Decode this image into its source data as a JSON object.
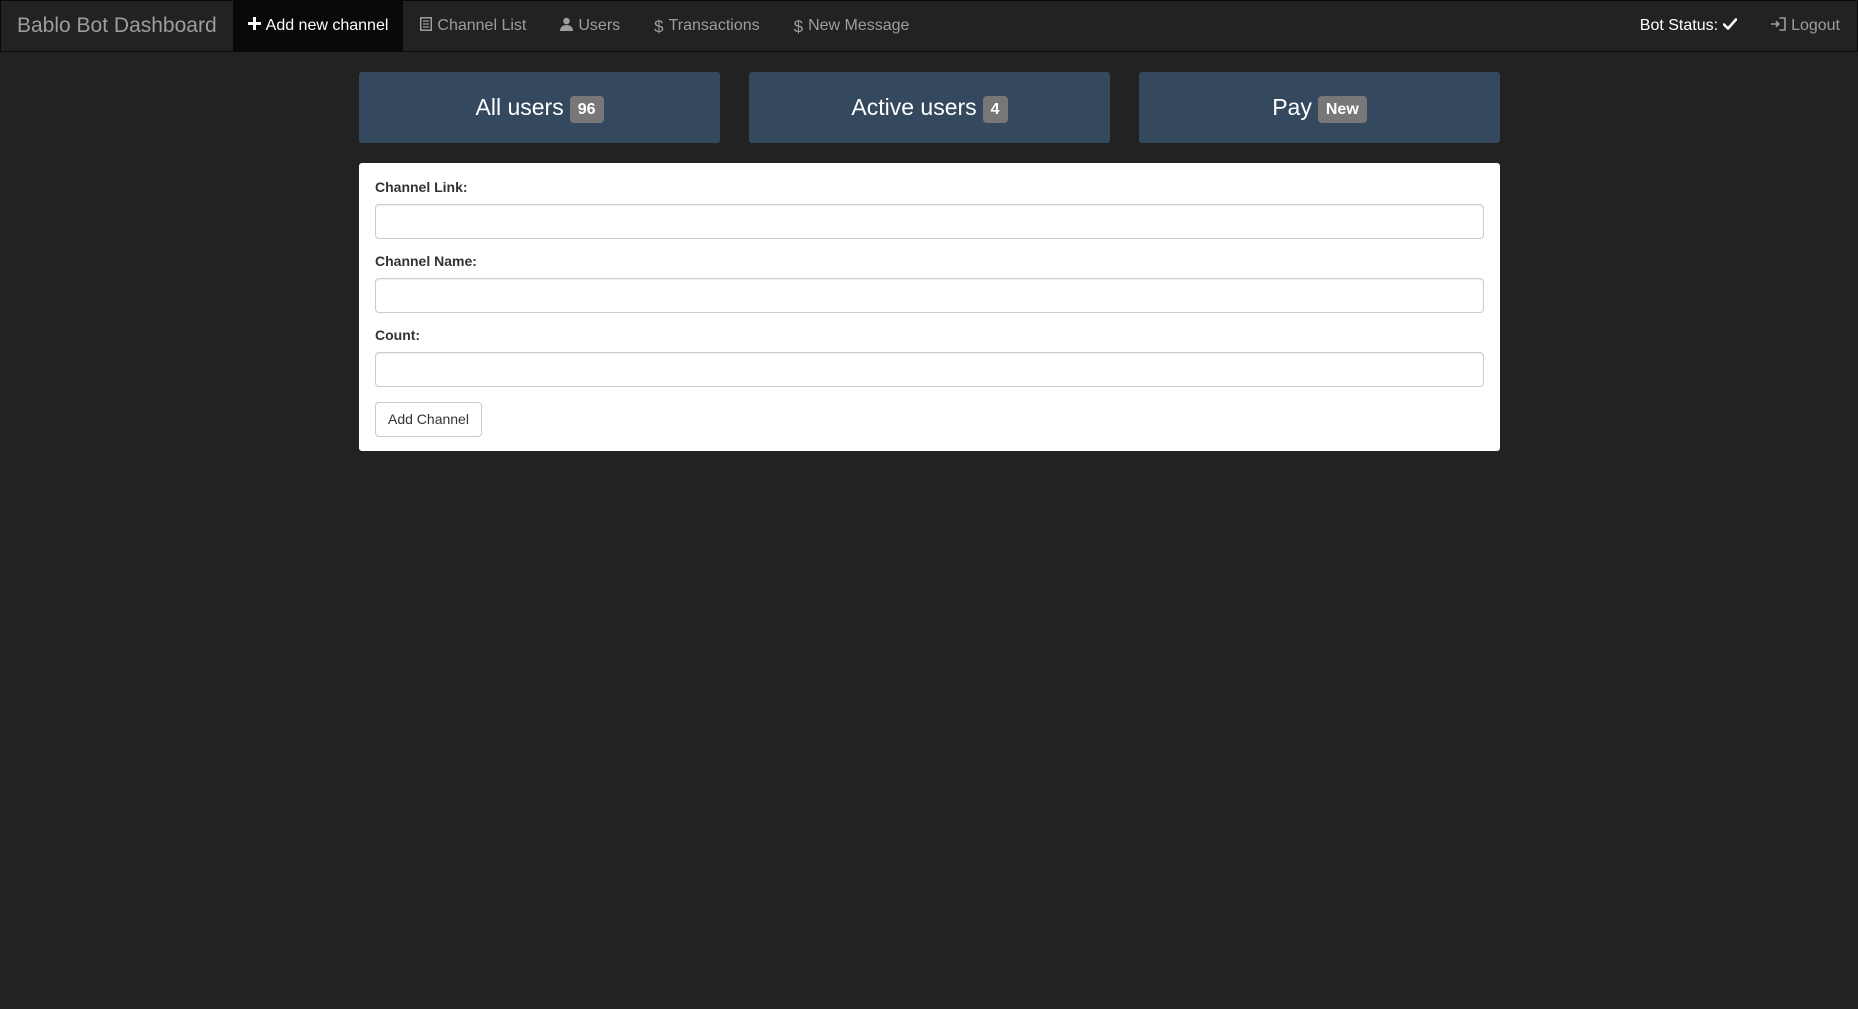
{
  "navbar": {
    "brand": "Bablo Bot Dashboard",
    "items": [
      {
        "label": "Add new channel",
        "icon": "plus-icon",
        "active": true
      },
      {
        "label": "Channel List",
        "icon": "list-icon"
      },
      {
        "label": "Users",
        "icon": "user-icon"
      },
      {
        "label": "Transactions",
        "icon": "dollar-icon"
      },
      {
        "label": "New Message",
        "icon": "dollar-icon"
      }
    ],
    "status_label": "Bot Status:",
    "status_icon": "checkmark-icon",
    "logout_label": "Logout",
    "logout_icon": "log-in-icon"
  },
  "stats": [
    {
      "label": "All users",
      "badge": "96"
    },
    {
      "label": "Active users",
      "badge": "4"
    },
    {
      "label": "Pay",
      "badge": "New"
    }
  ],
  "form": {
    "fields": [
      {
        "label": "Channel Link:",
        "value": "",
        "placeholder": ""
      },
      {
        "label": "Channel Name:",
        "value": "",
        "placeholder": ""
      },
      {
        "label": "Count:",
        "value": "",
        "placeholder": ""
      }
    ],
    "submit_label": "Add Channel"
  },
  "colors": {
    "background": "#222222",
    "navbar_active": "#080808",
    "stat_box": "#34495e",
    "badge": "#777777",
    "panel": "#ffffff"
  }
}
